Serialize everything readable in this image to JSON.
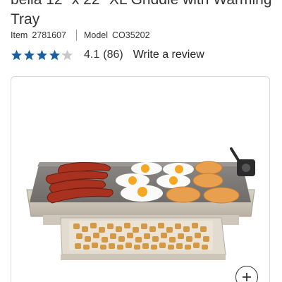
{
  "product": {
    "title": "bella 12\" x 22\" XL Griddle with Warming Tray",
    "item_label": "Item",
    "item_number": "2781607",
    "model_label": "Model",
    "model_number": "CO35202"
  },
  "rating": {
    "stars": 4.1,
    "value": "4.1",
    "count": "(86)",
    "write_review": "Write a review",
    "star_color": "#1b5f9e",
    "empty_star_color": "#c8c8c8"
  },
  "gallery": {
    "zoom_icon": "plus-icon"
  }
}
